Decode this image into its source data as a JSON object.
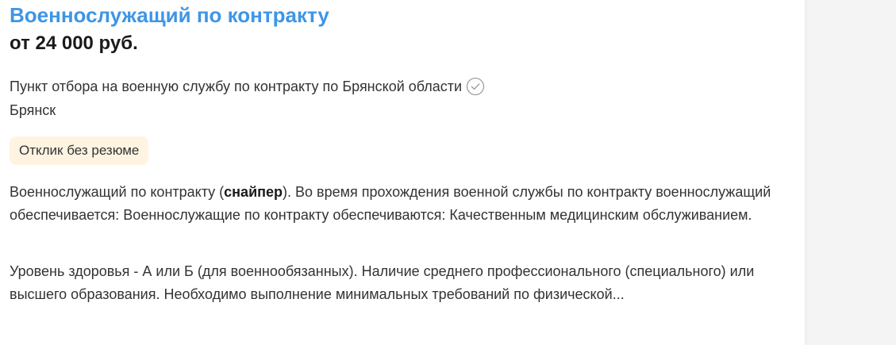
{
  "vacancy": {
    "title": "Военнослужащий по контракту",
    "salary": "от 24 000 руб.",
    "company": "Пункт отбора на военную службу по контракту по Брянской области",
    "company_verified_icon": "verified-check-circle-icon",
    "city": "Брянск",
    "badge": "Отклик без резюме",
    "snippet_1": {
      "before": "Военнослужащий по контракту (",
      "highlight": "снайпер",
      "after": "). Во время прохождения военной службы по контракту военнослужащий обеспечивается: Военнослужащие по контракту обеспечиваются: Качественным медицинским обслуживанием."
    },
    "snippet_2": "Уровень здоровья - А или Б (для военнообязанных). Наличие среднего профессионального (специального) или высшего образования. Необходимо выполнение минимальных требований по физической..."
  },
  "colors": {
    "title": "#3e95e6",
    "badge_bg": "#fff4e2",
    "text": "#333333",
    "page_bg": "#f4f4f5"
  }
}
